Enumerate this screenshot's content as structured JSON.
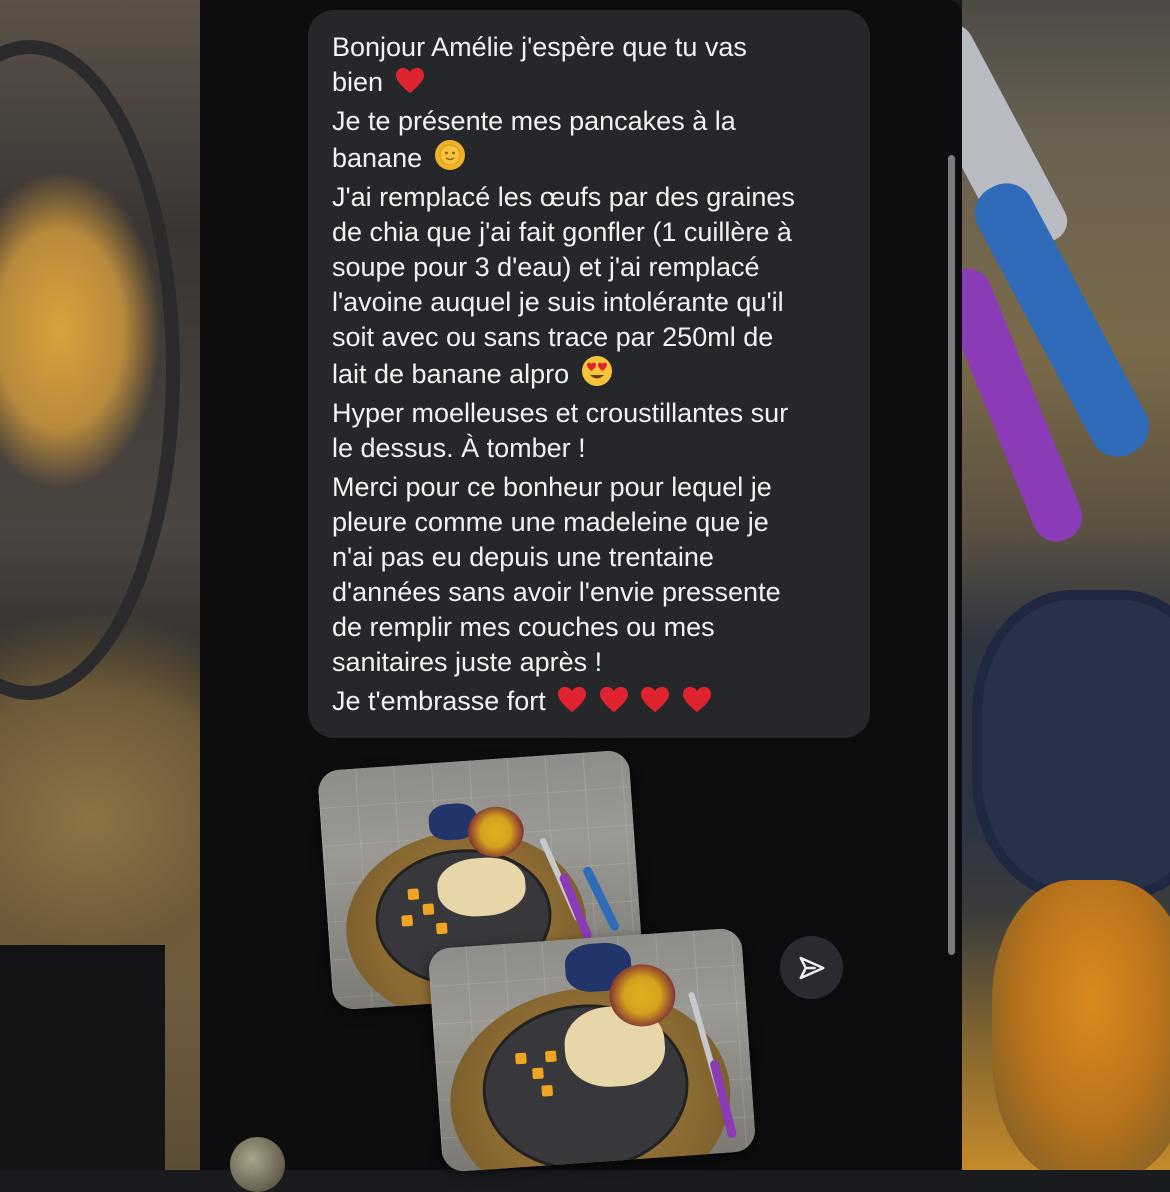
{
  "message": {
    "lines": [
      "Bonjour Amélie j'espère que tu vas",
      "bien",
      "Je te présente mes pancakes à la",
      "banane",
      "J'ai remplacé les œufs par des graines",
      "de chia que j'ai fait gonfler (1 cuillère à",
      "soupe pour 3 d'eau) et j'ai remplacé",
      "l'avoine auquel je suis intolérante qu'il",
      "soit avec ou sans trace par 250ml de",
      "lait de banane alpro",
      "Hyper moelleuses et croustillantes sur",
      "le dessus. À tomber !",
      "Merci pour ce bonheur pour lequel je",
      "pleure comme une madeleine que je",
      "n'ai pas eu depuis une trentaine",
      "d'années sans avoir l'envie pressente",
      "de remplir mes couches ou mes",
      "sanitaires juste après !",
      "Je t'embrasse fort"
    ],
    "emojis": [
      "red-heart",
      "sun-with-face",
      "smiling-face-with-heart-eyes",
      "red-heart-x4"
    ]
  },
  "attachments": [
    {
      "type": "photo",
      "subject": "pancakes-with-passion-fruit"
    },
    {
      "type": "photo",
      "subject": "pancakes-with-passion-fruit"
    }
  ],
  "colors": {
    "panel": "#0d0d10",
    "bubble": "#26272b",
    "text": "#f2f2f4",
    "heart": "#e0242f",
    "send_button": "#2a2b30"
  },
  "icons": {
    "send": "paper-plane-icon",
    "avatar": "user-avatar"
  }
}
